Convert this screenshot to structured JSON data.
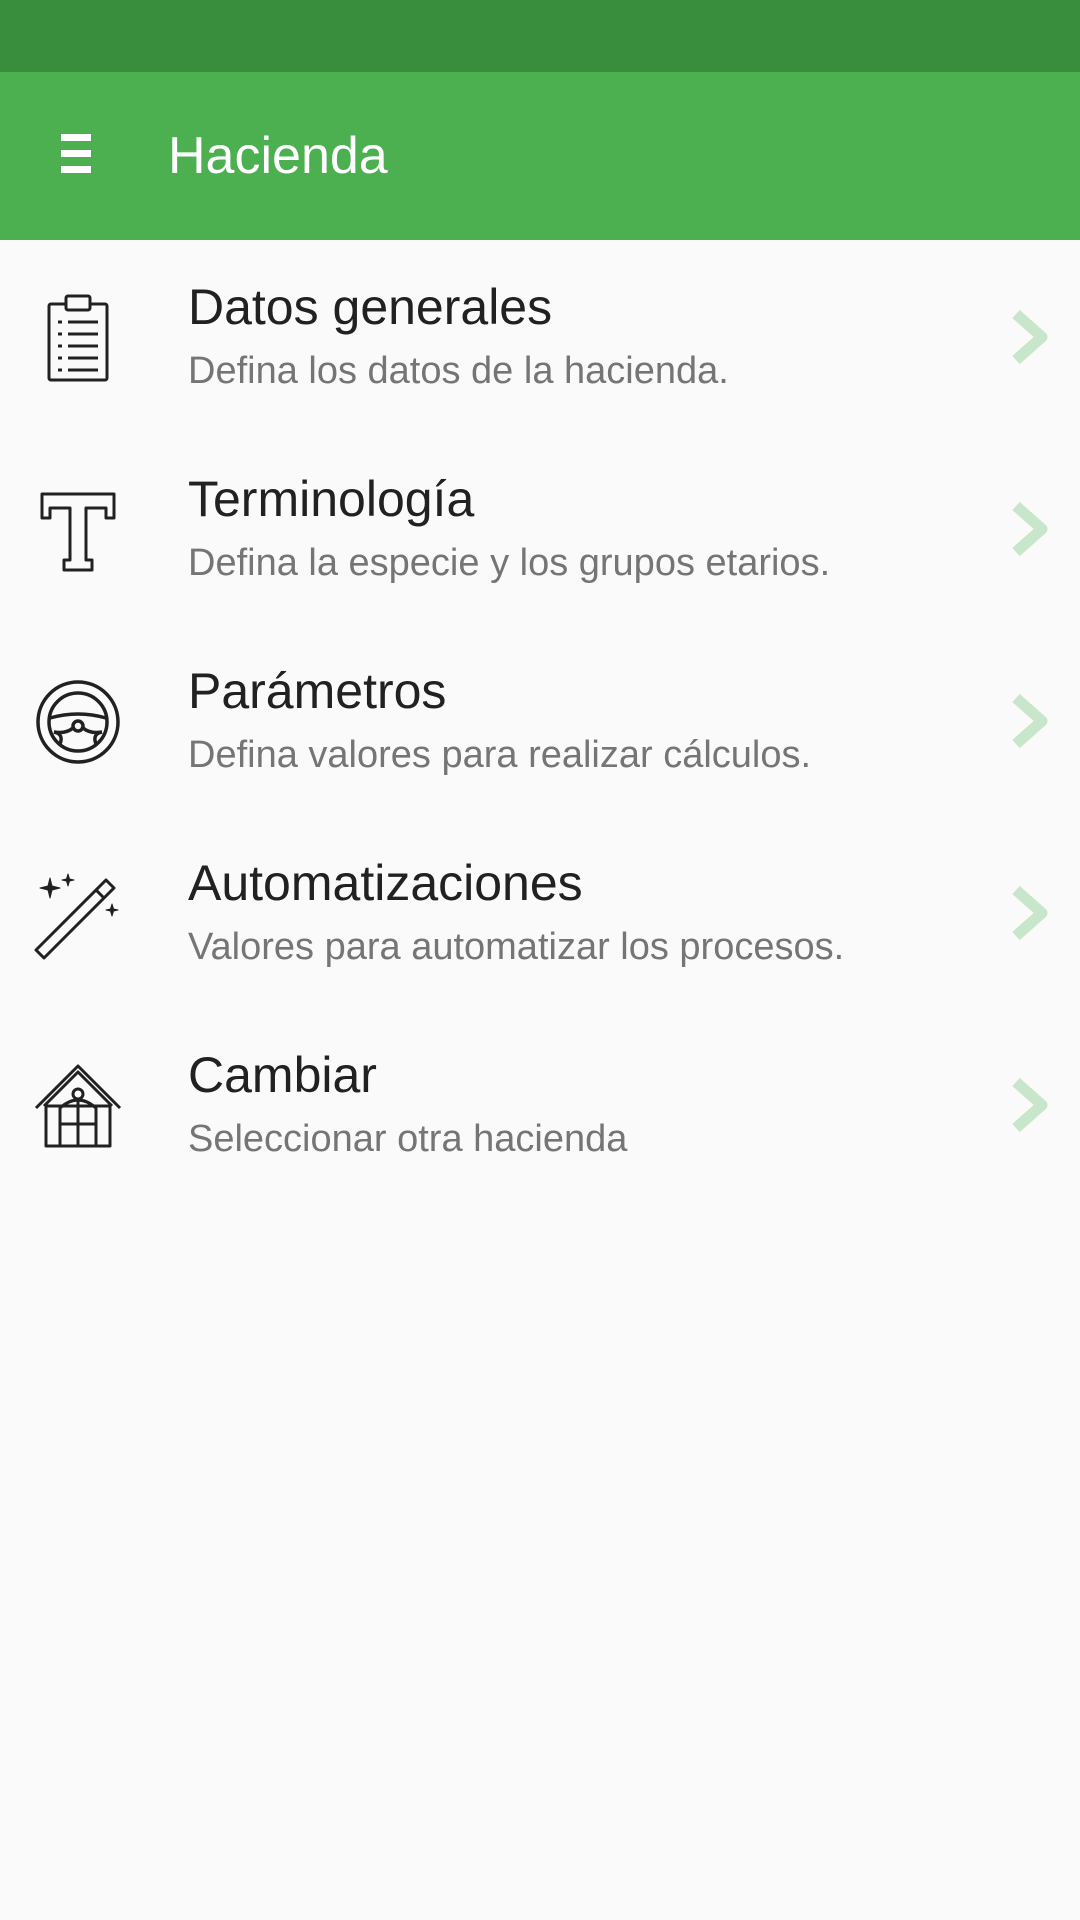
{
  "app_bar": {
    "title": "Hacienda",
    "menu_icon": "hamburger-menu-icon"
  },
  "colors": {
    "status_bar": "#388e3c",
    "app_bar": "#4caf50",
    "chevron": "#c8e6c9",
    "title_text": "#212121",
    "subtitle_text": "#757575"
  },
  "items": [
    {
      "title": "Datos generales",
      "subtitle": "Defina los datos de la hacienda.",
      "icon": "clipboard-icon"
    },
    {
      "title": "Terminología",
      "subtitle": "Defina la especie y los grupos etarios.",
      "icon": "letter-t-icon"
    },
    {
      "title": "Parámetros",
      "subtitle": "Defina valores para realizar cálculos.",
      "icon": "steering-wheel-icon"
    },
    {
      "title": "Automatizaciones",
      "subtitle": "Valores para automatizar los procesos.",
      "icon": "magic-wand-icon"
    },
    {
      "title": "Cambiar",
      "subtitle": "Seleccionar otra hacienda",
      "icon": "farmhouse-icon"
    }
  ]
}
